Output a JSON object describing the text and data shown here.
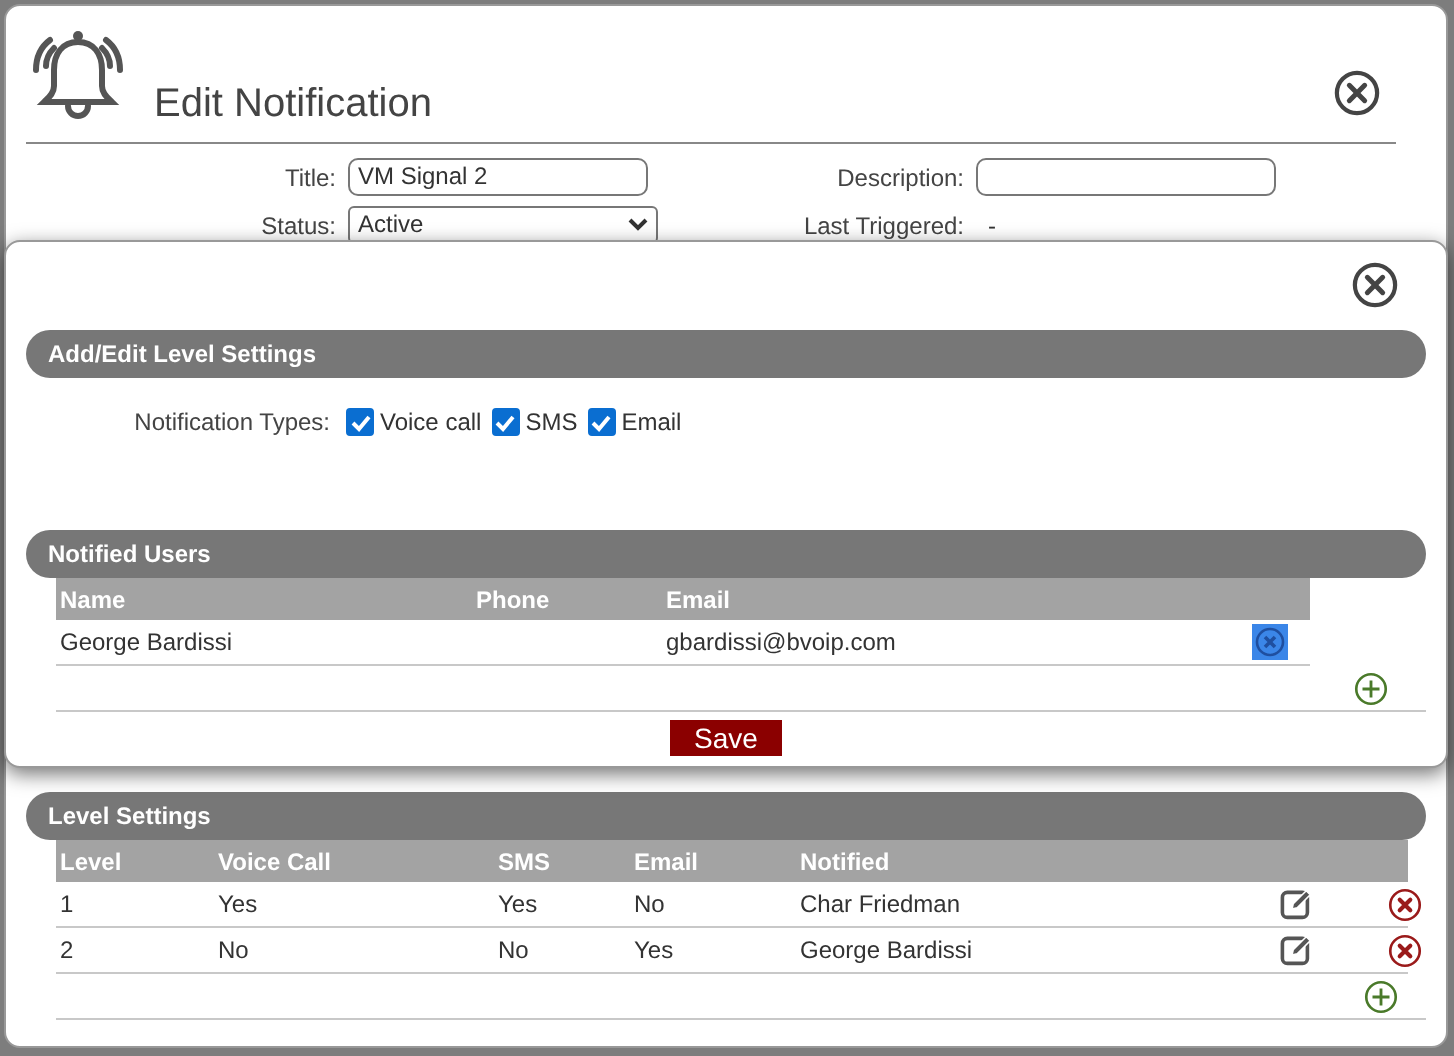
{
  "window": {
    "title": "Edit Notification"
  },
  "form": {
    "fields": [
      {
        "label": "Title:",
        "value": "VM Signal 2",
        "kind": "text"
      },
      {
        "label": "Description:",
        "kind": "text"
      },
      {
        "label": "Status:",
        "value": "Active",
        "kind": "select"
      },
      {
        "label": "Last Triggered:",
        "value": "-",
        "kind": "static"
      }
    ]
  },
  "level_dialog": {
    "section_title": "Add/Edit Level Settings",
    "types_label": "Notification Types:",
    "types": [
      {
        "label": "Voice call",
        "checked": true
      },
      {
        "label": "SMS",
        "checked": true
      },
      {
        "label": "Email",
        "checked": true
      }
    ],
    "users_title": "Notified Users",
    "users_columns": [
      "Name",
      "Phone",
      "Email"
    ],
    "users_rows": [
      {
        "name": "George Bardissi",
        "email": "gbardissi@bvoip.com"
      }
    ],
    "save": "Save"
  },
  "level_settings": {
    "title": "Level Settings",
    "columns": [
      "Level",
      "Voice Call",
      "SMS",
      "Email",
      "Notified"
    ],
    "rows": [
      {
        "cells": [
          "1",
          "Yes",
          "Yes",
          "No",
          "Char Friedman"
        ]
      },
      {
        "cells": [
          "2",
          "No",
          "No",
          "Yes",
          "George Bardissi"
        ]
      }
    ]
  }
}
